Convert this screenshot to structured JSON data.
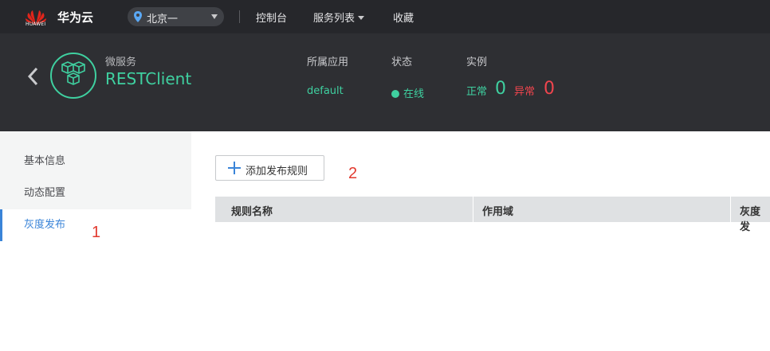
{
  "topnav": {
    "logo_text": "HUAWEI",
    "brand": "华为云",
    "region": "北京一",
    "console": "控制台",
    "services": "服务列表",
    "favorites": "收藏"
  },
  "header": {
    "service_type": "微服务",
    "service_name": "RESTClient",
    "app_label": "所属应用",
    "app_value": "default",
    "status_label": "状态",
    "status_value": "在线",
    "instance_label": "实例",
    "normal_label": "正常",
    "normal_count": "0",
    "abnormal_label": "异常",
    "abnormal_count": "0"
  },
  "sidebar": {
    "items": [
      {
        "label": "基本信息"
      },
      {
        "label": "动态配置"
      },
      {
        "label": "灰度发布"
      }
    ]
  },
  "main": {
    "add_button": "添加发布规则",
    "columns": [
      "规则名称",
      "作用域",
      "灰度发"
    ]
  },
  "annotations": [
    "1",
    "2"
  ],
  "colors": {
    "accent": "#3fd0a0",
    "active_link": "#3a84d8",
    "danger": "#f0454e",
    "annotation": "#e23a2f"
  }
}
